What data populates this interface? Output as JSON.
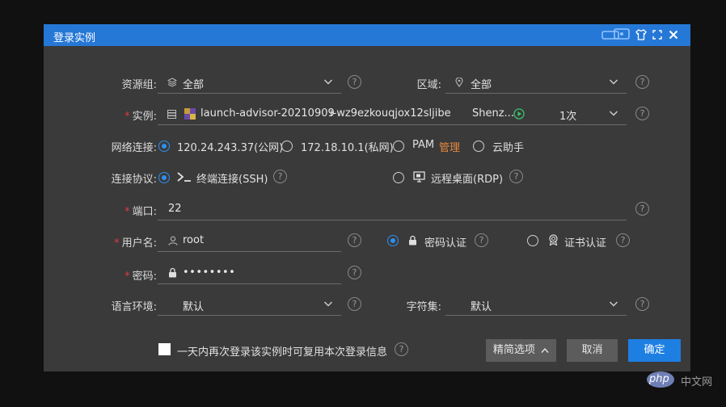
{
  "dialog": {
    "title": "登录实例"
  },
  "resource_group": {
    "label": "资源组:",
    "value": "全部"
  },
  "region": {
    "label": "区域:",
    "value": "全部"
  },
  "instance": {
    "required_mark": "*",
    "label": "实例:",
    "name": "launch-advisor-20210909",
    "id": "i-wz9ezkouqjox12sljibe",
    "zone": "Shenz...",
    "count": "1次"
  },
  "network": {
    "label": "网络连接:",
    "options": [
      {
        "text": "120.24.243.37(公网)",
        "selected": true
      },
      {
        "text": "172.18.10.1(私网)",
        "selected": false
      },
      {
        "text": "PAM",
        "selected": false
      },
      {
        "text": "云助手",
        "selected": false
      }
    ],
    "pam_manage": "管理"
  },
  "protocol": {
    "label": "连接协议:",
    "options": [
      {
        "text": "终端连接(SSH)",
        "selected": true
      },
      {
        "text": "远程桌面(RDP)",
        "selected": false
      }
    ]
  },
  "port": {
    "required_mark": "*",
    "label": "端口:",
    "value": "22"
  },
  "username": {
    "required_mark": "*",
    "label": "用户名:",
    "value": "root"
  },
  "auth": {
    "options": [
      {
        "text": "密码认证",
        "selected": true
      },
      {
        "text": "证书认证",
        "selected": false
      }
    ]
  },
  "password": {
    "required_mark": "*",
    "label": "密码:",
    "value": "••••••••"
  },
  "locale": {
    "label": "语言环境:",
    "value": "默认"
  },
  "charset": {
    "label": "字符集:",
    "value": "默认"
  },
  "remember": {
    "text": "一天内再次登录该实例时可复用本次登录信息",
    "checked": false
  },
  "buttons": {
    "advanced": "精简选项",
    "cancel": "取消",
    "ok": "确定"
  },
  "help_glyph": "?",
  "watermark": {
    "brand": "php",
    "site": "中文网"
  },
  "colors": {
    "title_bar": "#2678d6",
    "dialog_bg": "#3a3a3a",
    "accent": "#2e8ff0",
    "required": "#e03b3b",
    "pam_manage": "#e8873a"
  }
}
